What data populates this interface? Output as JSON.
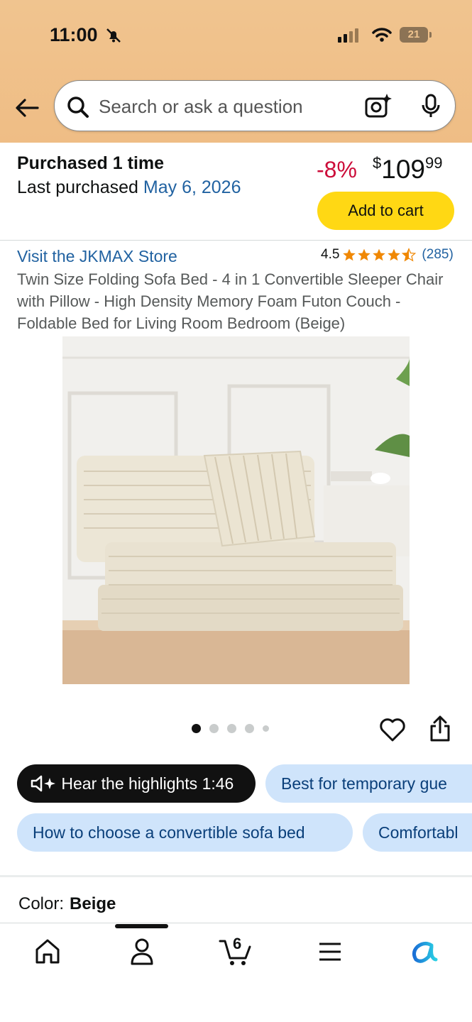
{
  "status_bar": {
    "time": "11:00",
    "battery": "21"
  },
  "search": {
    "placeholder": "Search or ask a question"
  },
  "purchase": {
    "purchased_text": "Purchased 1 time",
    "last_purchased_label": "Last purchased",
    "last_purchased_date": "May 6, 2026",
    "discount": "-8%",
    "price_symbol": "$",
    "price_whole": "109",
    "price_cents": "99",
    "add_to_cart": "Add to cart"
  },
  "product": {
    "store_link": "Visit the JKMAX Store",
    "rating": "4.5",
    "rating_value": 4.5,
    "review_count": "(285)",
    "title": "Twin Size Folding Sofa Bed - 4 in 1 Convertible Sleeper Chair with Pillow - High Density Memory Foam Futon Couch - Foldable Bed for Living Room Bedroom (Beige)",
    "image_count": 5,
    "active_image": 1
  },
  "chips": [
    {
      "label": "Hear the highlights 1:46",
      "style": "dark"
    },
    {
      "label": "Best for temporary gue",
      "style": "blue"
    },
    {
      "label": "How to choose a convertible sofa bed",
      "style": "blue"
    },
    {
      "label": "Comfortabl",
      "style": "blue"
    }
  ],
  "color": {
    "label": "Color:",
    "value": "Beige"
  },
  "tabbar": {
    "cart_count": "6",
    "items": [
      "home-icon",
      "account-icon",
      "cart-icon",
      "menu-icon",
      "rufus-icon"
    ]
  },
  "colors": {
    "header_bg": "#f0c48f",
    "link": "#2162a1",
    "discount": "#cc0c39",
    "cart_button": "#ffd814",
    "star": "#f08804",
    "chip_blue": "#cfe4fb"
  }
}
